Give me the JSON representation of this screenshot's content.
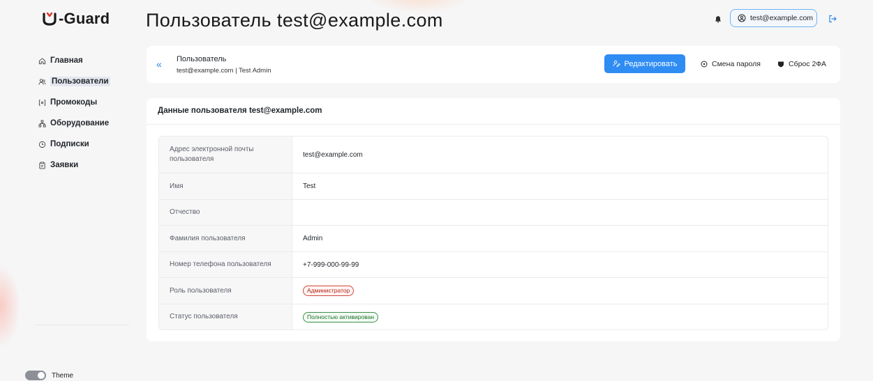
{
  "app": {
    "logo_text": "-Guard"
  },
  "header": {
    "title": "Пользователь test@example.com",
    "user_email": "test@example.com"
  },
  "sidebar": {
    "items": [
      {
        "label": "Главная",
        "icon": "home-icon"
      },
      {
        "label": "Пользователи",
        "icon": "users-icon",
        "active": true
      },
      {
        "label": "Промокоды",
        "icon": "promo-icon"
      },
      {
        "label": "Оборудование",
        "icon": "hardware-icon"
      },
      {
        "label": "Подписки",
        "icon": "clock-icon"
      },
      {
        "label": "Заявки",
        "icon": "clipboard-icon"
      }
    ],
    "theme_label": "Theme"
  },
  "user_card": {
    "title": "Пользователь",
    "subtitle": "test@example.com | Test Admin",
    "back_glyph": "«",
    "edit_label": "Редактировать",
    "password_label": "Смена пароля",
    "reset_2fa_label": "Сброс 2ФА"
  },
  "details": {
    "title": "Данные пользователя test@example.com",
    "rows": [
      {
        "key": "Адрес электронной почты пользователя",
        "value": "test@example.com"
      },
      {
        "key": "Имя",
        "value": "Test"
      },
      {
        "key": "Отчество",
        "value": ""
      },
      {
        "key": "Фамилия пользователя",
        "value": "Admin"
      },
      {
        "key": "Номер телефона пользователя",
        "value": "+7-999-000-99-99"
      },
      {
        "key": "Роль пользователя",
        "value": "Администратор"
      },
      {
        "key": "Статус пользователя",
        "value": "Полностью активирован"
      }
    ]
  },
  "colors": {
    "accent": "#2f8cf3",
    "role_badge": "#b42318",
    "status_badge": "#1f6f2b"
  }
}
